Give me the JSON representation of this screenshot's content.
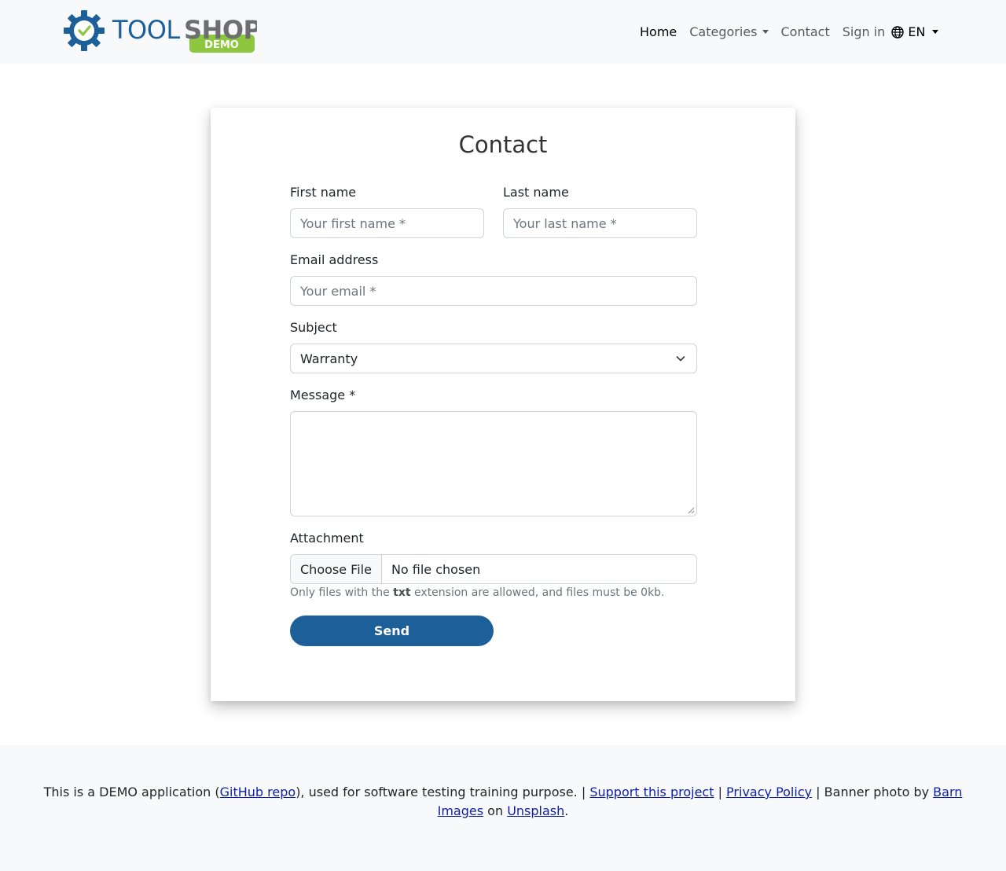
{
  "header": {
    "logo": {
      "text_main": "TOOLSHOP",
      "badge": "DEMO"
    },
    "nav": {
      "home": "Home",
      "categories": "Categories",
      "contact": "Contact",
      "sign_in": "Sign in",
      "language": "EN"
    }
  },
  "form": {
    "title": "Contact",
    "first_name": {
      "label": "First name",
      "placeholder": "Your first name *"
    },
    "last_name": {
      "label": "Last name",
      "placeholder": "Your last name *"
    },
    "email": {
      "label": "Email address",
      "placeholder": "Your email *"
    },
    "subject": {
      "label": "Subject",
      "value": "Warranty"
    },
    "message": {
      "label": "Message *"
    },
    "attachment": {
      "label": "Attachment",
      "button": "Choose File",
      "status": "No file chosen",
      "help_prefix": "Only files with the ",
      "help_ext": "txt",
      "help_suffix": " extension are allowed, and files must be 0kb."
    },
    "send": "Send"
  },
  "footer": {
    "t1": "This is a DEMO application (",
    "github": "GitHub repo",
    "t2": "), used for software testing training purpose. | ",
    "support": "Support this project",
    "t3": " | ",
    "privacy": "Privacy Policy",
    "t4": " | Banner photo by ",
    "barn": "Barn Images",
    "t5": " on ",
    "unsplash": "Unsplash",
    "t6": "."
  },
  "colors": {
    "brand_blue": "#1d5f99",
    "brand_green": "#8dc63f",
    "logo_gray": "#6d6e71"
  }
}
